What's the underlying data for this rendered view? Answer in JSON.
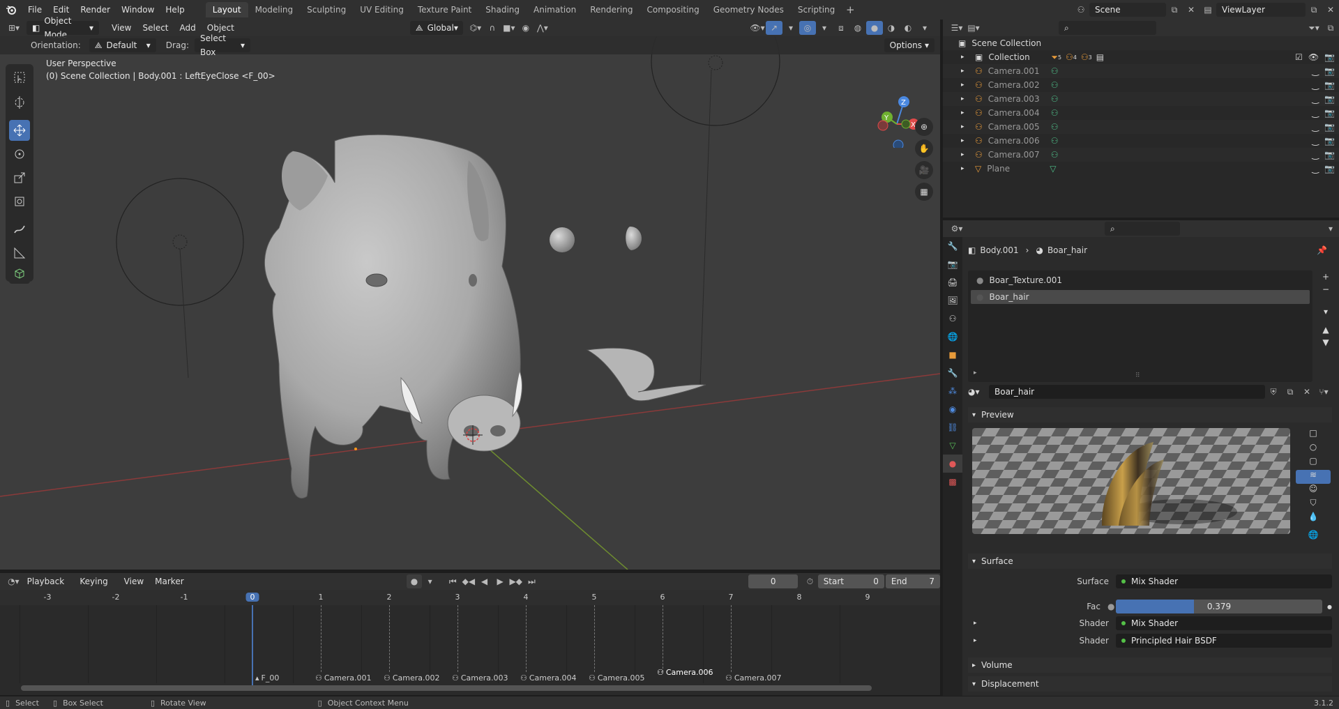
{
  "topbar": {
    "menus": [
      "File",
      "Edit",
      "Render",
      "Window",
      "Help"
    ],
    "workspaces": [
      "Layout",
      "Modeling",
      "Sculpting",
      "UV Editing",
      "Texture Paint",
      "Shading",
      "Animation",
      "Rendering",
      "Compositing",
      "Geometry Nodes",
      "Scripting"
    ],
    "active_workspace": "Layout",
    "scene": "Scene",
    "view_layer": "ViewLayer"
  },
  "viewport": {
    "mode": "Object Mode",
    "menus": [
      "View",
      "Select",
      "Add",
      "Object"
    ],
    "transform": "Global",
    "orientation_label": "Orientation:",
    "orientation": "Default",
    "drag_label": "Drag:",
    "drag": "Select Box",
    "options": "Options",
    "perspective": "User Perspective",
    "info": "(0) Scene Collection | Body.001 : LeftEyeClose <F_00>",
    "gizmo_x": "X",
    "gizmo_y": "Y",
    "gizmo_z": "Z"
  },
  "outliner": {
    "root": "Scene Collection",
    "collection": "Collection",
    "collection_badges": [
      "5",
      "4",
      "3"
    ],
    "items": [
      {
        "name": "Camera.001",
        "type": "camera"
      },
      {
        "name": "Camera.002",
        "type": "camera"
      },
      {
        "name": "Camera.003",
        "type": "camera"
      },
      {
        "name": "Camera.004",
        "type": "camera"
      },
      {
        "name": "Camera.005",
        "type": "camera"
      },
      {
        "name": "Camera.006",
        "type": "camera"
      },
      {
        "name": "Camera.007",
        "type": "camera"
      },
      {
        "name": "Plane",
        "type": "mesh"
      }
    ]
  },
  "properties": {
    "breadcrumb_object": "Body.001",
    "breadcrumb_material": "Boar_hair",
    "material_slots": [
      "Boar_Texture.001",
      "Boar_hair"
    ],
    "active_slot": "Boar_hair",
    "material_name": "Boar_hair",
    "preview_label": "Preview",
    "surface_label": "Surface",
    "surface_field_label": "Surface",
    "surface_value": "Mix Shader",
    "fac_label": "Fac",
    "fac_value": "0.379",
    "fac_fraction": 0.379,
    "shader1_label": "Shader",
    "shader1_value": "Mix Shader",
    "shader2_label": "Shader",
    "shader2_value": "Principled Hair BSDF",
    "volume_label": "Volume",
    "displacement_label": "Displacement"
  },
  "timeline": {
    "menus": [
      "Playback",
      "Keying",
      "View",
      "Marker"
    ],
    "current_frame": "0",
    "start_label": "Start",
    "start": "0",
    "end_label": "End",
    "end": "7",
    "ticks": [
      "-3",
      "-2",
      "-1",
      "0",
      "1",
      "2",
      "3",
      "4",
      "5",
      "6",
      "7",
      "8",
      "9"
    ],
    "markers": [
      "F_00",
      "Camera.001",
      "Camera.002",
      "Camera.003",
      "Camera.004",
      "Camera.005",
      "Camera.006",
      "Camera.007"
    ]
  },
  "status": {
    "select": "Select",
    "box_select": "Box Select",
    "rotate_view": "Rotate View",
    "context_menu": "Object Context Menu",
    "version": "3.1.2"
  }
}
